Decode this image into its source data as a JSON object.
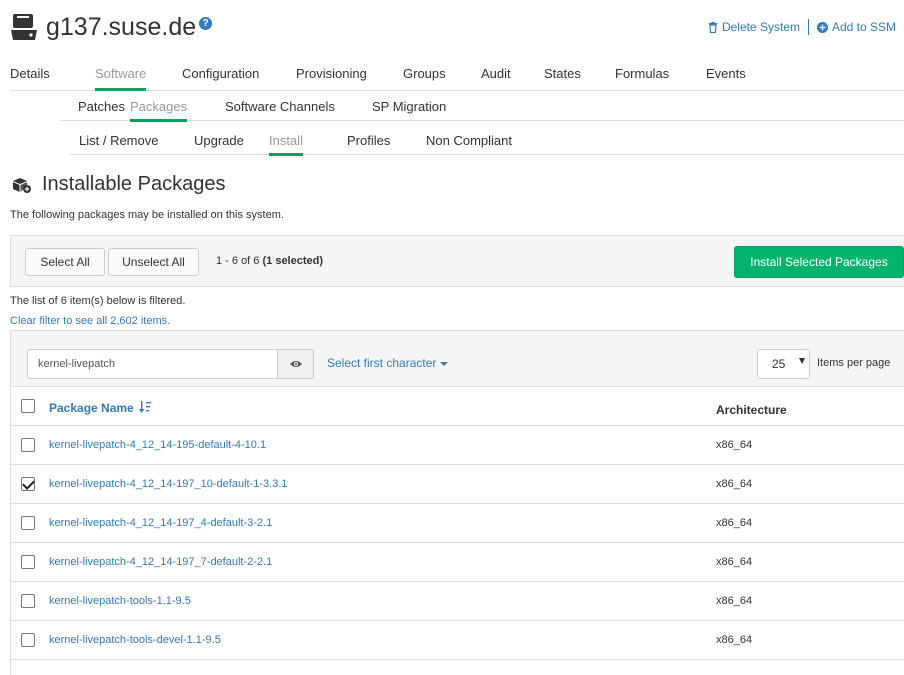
{
  "header": {
    "title": "g137.suse.de",
    "help_icon": "question-circle-icon",
    "system_icon": "server-icon",
    "delete_label": "Delete System",
    "add_ssm_label": "Add to SSM"
  },
  "tabs_level1": [
    {
      "label": "Details",
      "active": false
    },
    {
      "label": "Software",
      "active": true
    },
    {
      "label": "Configuration",
      "active": false
    },
    {
      "label": "Provisioning",
      "active": false
    },
    {
      "label": "Groups",
      "active": false
    },
    {
      "label": "Audit",
      "active": false
    },
    {
      "label": "States",
      "active": false
    },
    {
      "label": "Formulas",
      "active": false
    },
    {
      "label": "Events",
      "active": false
    }
  ],
  "tabs_level2": [
    {
      "label": "Patches",
      "active": false
    },
    {
      "label": "Packages",
      "active": true
    },
    {
      "label": "Software Channels",
      "active": false
    },
    {
      "label": "SP Migration",
      "active": false
    }
  ],
  "tabs_level3": [
    {
      "label": "List / Remove",
      "active": false
    },
    {
      "label": "Upgrade",
      "active": false
    },
    {
      "label": "Install",
      "active": true
    },
    {
      "label": "Profiles",
      "active": false
    },
    {
      "label": "Non Compliant",
      "active": false
    }
  ],
  "section": {
    "title": "Installable Packages",
    "description": "The following packages may be installed on this system."
  },
  "toolbar": {
    "select_all": "Select All",
    "unselect_all": "Unselect All",
    "range": "1 - 6 of 6 ",
    "selected": "(1 selected)",
    "install_button": "Install Selected Packages"
  },
  "filter": {
    "note": "The list of 6 item(s) below is filtered.",
    "clear_link": "Clear filter to see all 2,602 items.",
    "value": "kernel-livepatch",
    "first_char_label": "Select first character",
    "per_page_value": "25",
    "per_page_label": "Items per page"
  },
  "table": {
    "col_name": "Package Name",
    "col_arch": "Architecture",
    "rows": [
      {
        "name": "kernel-livepatch-4_12_14-195-default-4-10.1",
        "arch": "x86_64",
        "checked": false
      },
      {
        "name": "kernel-livepatch-4_12_14-197_10-default-1-3.3.1",
        "arch": "x86_64",
        "checked": true
      },
      {
        "name": "kernel-livepatch-4_12_14-197_4-default-3-2.1",
        "arch": "x86_64",
        "checked": false
      },
      {
        "name": "kernel-livepatch-4_12_14-197_7-default-2-2.1",
        "arch": "x86_64",
        "checked": false
      },
      {
        "name": "kernel-livepatch-tools-1.1-9.5",
        "arch": "x86_64",
        "checked": false
      },
      {
        "name": "kernel-livepatch-tools-devel-1.1-9.5",
        "arch": "x86_64",
        "checked": false
      }
    ]
  },
  "colors": {
    "accent": "#00a25f",
    "link": "#337ab7",
    "install_button": "#00b46e"
  }
}
